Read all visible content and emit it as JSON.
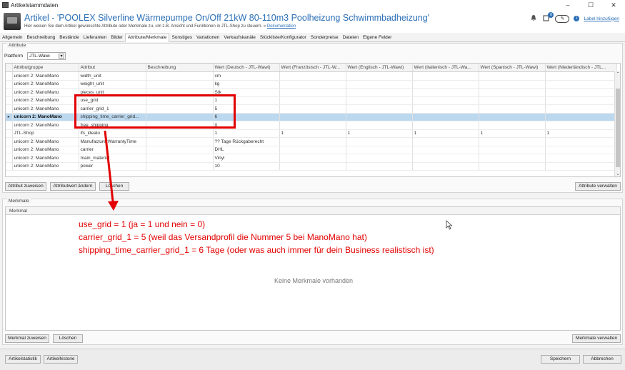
{
  "window": {
    "title": "Artikelstammdaten",
    "controls": [
      "–",
      "☐",
      "✕"
    ]
  },
  "header": {
    "title": "Artikel - 'POOLEX Silverline Wärmepumpe On/Off 21kW 80-110m3 Poolheizung Schwimmbadheizung'",
    "subtitle": "Hier weisen Sie dem Artikel gewünschte Attribute oder Merkmale zu, um z.B. Ansicht und Funktionen in JTL-Shop zu steuern. »",
    "doc_link": "Dokumentation",
    "notification_badge": "8",
    "label_link": "Label hinzufügen"
  },
  "tabs": [
    {
      "label": "Allgemein"
    },
    {
      "label": "Beschreibung"
    },
    {
      "label": "Bestände"
    },
    {
      "label": "Lieferanten"
    },
    {
      "label": "Bilder"
    },
    {
      "label": "Attribute/Merkmale",
      "active": true
    },
    {
      "label": "Sonstiges"
    },
    {
      "label": "Variationen"
    },
    {
      "label": "Verkaufskanäle"
    },
    {
      "label": "Stückliste/Konfigurator"
    },
    {
      "label": "Sonderpreise"
    },
    {
      "label": "Dateien"
    },
    {
      "label": "Eigene Felder"
    }
  ],
  "attributes_section": {
    "legend": "Attribute",
    "platform_label": "Plattform",
    "platform_value": "JTL-Wawi",
    "columns": [
      "Attributgruppe",
      "Attribut",
      "Beschreibung",
      "Wert (Deutsch - JTL-Wawi)",
      "Wert (Französisch - JTL-W...",
      "Wert (Englisch - JTL-Wawi)",
      "Wert (Italienisch - JTL-Wa...",
      "Wert (Spanisch - JTL-Wawi)",
      "Wert (Niederländisch - JTL..."
    ],
    "rows": [
      {
        "cells": [
          "unicorn 2: ManoMano",
          "width_unit",
          "",
          "cm",
          "",
          "",
          "",
          "",
          ""
        ]
      },
      {
        "cells": [
          "unicorn 2: ManoMano",
          "weight_unit",
          "",
          "kg",
          "",
          "",
          "",
          "",
          ""
        ]
      },
      {
        "cells": [
          "unicorn 2: ManoMano",
          "pieces_unit",
          "",
          "Stk",
          "",
          "",
          "",
          "",
          ""
        ]
      },
      {
        "cells": [
          "unicorn 2: ManoMano",
          "use_grid",
          "",
          "1",
          "",
          "",
          "",
          "",
          ""
        ]
      },
      {
        "cells": [
          "unicorn 2: ManoMano",
          "carrier_grid_1",
          "",
          "5",
          "",
          "",
          "",
          "",
          ""
        ]
      },
      {
        "cells": [
          "unicorn 2: ManoMano",
          "shipping_time_carrier_grid...",
          "",
          "6",
          "",
          "",
          "",
          "",
          ""
        ],
        "selected": true,
        "indicator": "▸"
      },
      {
        "cells": [
          "unicorn 2: ManoMano",
          "free_shipping",
          "",
          "0",
          "",
          "",
          "",
          "",
          ""
        ]
      },
      {
        "cells": [
          "JTL-Shop",
          "ifs_idealo",
          "",
          "1",
          "1",
          "1",
          "1",
          "1",
          "1"
        ]
      },
      {
        "cells": [
          "unicorn 2: ManoMano",
          "ManufacturerWarrantyTime",
          "",
          "?? Tage Rückgaberecht",
          "",
          "",
          "",
          "",
          ""
        ]
      },
      {
        "cells": [
          "unicorn 2: ManoMano",
          "carrier",
          "",
          "DHL",
          "",
          "",
          "",
          "",
          ""
        ]
      },
      {
        "cells": [
          "unicorn 2: ManoMano",
          "main_material",
          "",
          "Vinyl",
          "",
          "",
          "",
          "",
          ""
        ]
      },
      {
        "cells": [
          "unicorn 2: ManoMano",
          "power",
          "",
          "10",
          "",
          "",
          "",
          "",
          ""
        ]
      }
    ],
    "btn_assign": "Attribut zuweisen",
    "btn_change": "Attributwert ändern",
    "btn_delete": "Löschen",
    "btn_manage": "Attribute verwalten"
  },
  "features_section": {
    "legend": "Merkmale",
    "column": "Merkmal",
    "empty_text": "Keine Merkmale vorhanden",
    "btn_assign": "Merkmal zuweisen",
    "btn_delete": "Löschen",
    "btn_manage": "Merkmale verwalten"
  },
  "annotation": {
    "line1": "use_grid = 1 (ja = 1 und nein = 0)",
    "line2": "carrier_grid_1 = 5 (weil das Versandprofil die Nummer 5 bei ManoMano hat)",
    "line3": "shipping_time_carrier_grid_1 = 6 Tage (oder was auch immer für dein Business realistisch ist)",
    "color": "#e20000"
  },
  "footer": {
    "btn_stats": "Artikelstatistik",
    "btn_history": "Artikelhistorie",
    "btn_save": "Speichern",
    "btn_cancel": "Abbrechen"
  },
  "colors": {
    "accent": "#2b6fb6",
    "selection": "#bcd8ef",
    "annotation": "#e20000"
  }
}
